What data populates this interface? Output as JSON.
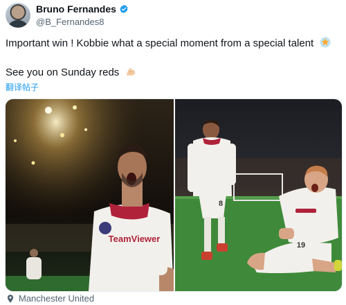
{
  "post": {
    "author_name": "Bruno Fernandes",
    "author_handle": "@B_Fernandes8",
    "text_line1": "Important win ! Kobbie what a special moment from a special talent",
    "text_line2": "See you on Sunday reds",
    "translate_label": "翻译帖子",
    "sponsor_text_left": "TeamViewer",
    "shirt_number": "8",
    "shirt_number_right": "19",
    "location_label": "Manchester United"
  },
  "colors": {
    "verified_blue": "#1d9bf0",
    "handle_gray": "#536471",
    "pitch_green": "#3f8a3a",
    "kit_white": "#f2f0ec",
    "kit_trim": "#b0223a"
  },
  "icons": {
    "verified": "verified-badge-icon",
    "star_emoji": "glowing-star-icon",
    "muscle_emoji": "flexed-biceps-icon",
    "location": "location-pin-icon"
  }
}
